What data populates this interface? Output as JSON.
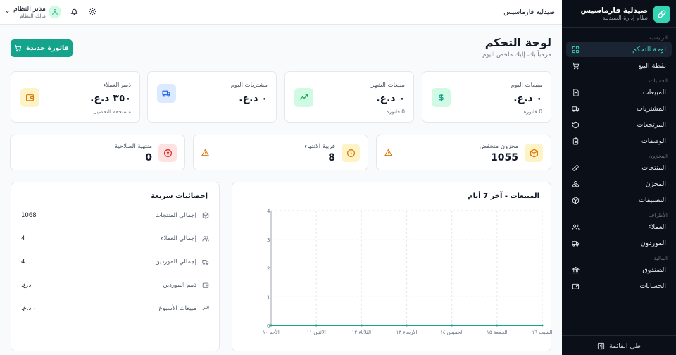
{
  "sidebar": {
    "brand_name": "صيدلية فارماسيس",
    "brand_sub": "نظام إدارة الصيدلية",
    "sections": {
      "main": "الرئيسية",
      "operations": "العمليات",
      "stock": "المخزون",
      "parties": "الأطراف",
      "finance": "المالية"
    },
    "items": {
      "dashboard": "لوحة التحكم",
      "pos": "نقطة البيع",
      "sales": "المبيعات",
      "purchases": "المشتريات",
      "returns": "المرتجعات",
      "prescriptions": "الوصفات",
      "products": "المنتجات",
      "warehouse": "المخزن",
      "categories": "التصنيفات",
      "customers": "العملاء",
      "suppliers": "الموردون",
      "cashbox": "الصندوق",
      "accounts": "الحسابات"
    },
    "collapse_label": "طي القائمة",
    "colors": {
      "background": "#0b0f17",
      "accent": "#34d3b3"
    }
  },
  "topbar": {
    "store_name": "صيدلية فارماسيس",
    "user_name": "مدير النظام",
    "user_role": "مالك النظام"
  },
  "page": {
    "title": "لوحة التحكم",
    "subtitle": "مرحباً بك، إليك ملخص اليوم",
    "new_invoice_label": "فاتورة جديدة"
  },
  "stats": {
    "today_sales": {
      "label": "مبيعات اليوم",
      "value": "٠ د.ع.",
      "note": "0 فاتورة"
    },
    "month_sales": {
      "label": "مبيعات الشهر",
      "value": "٠ د.ع.",
      "note": "0 فاتورة"
    },
    "today_purchases": {
      "label": "مشتريات اليوم",
      "value": "٠ د.ع."
    },
    "receivables": {
      "label": "ذمم العملاء",
      "value": "٣٥٠ د.ع.",
      "note": "مستحقة التحصيل"
    }
  },
  "alerts": {
    "low_stock": {
      "label": "مخزون منخفض",
      "value": "1055"
    },
    "near_expiry": {
      "label": "قريبة الانتهاء",
      "value": "8"
    },
    "expired": {
      "label": "منتهية الصلاحية",
      "value": "0"
    }
  },
  "quick_stats": {
    "title": "إحصائيات سريعة",
    "rows": [
      {
        "label": "إجمالي المنتجات",
        "value": "1068"
      },
      {
        "label": "إجمالي العملاء",
        "value": "4"
      },
      {
        "label": "إجمالي الموردين",
        "value": "4"
      },
      {
        "label": "ذمم الموردين",
        "value": "٠ د.ع."
      },
      {
        "label": "مبيعات الأسبوع",
        "value": "٠ د.ع."
      }
    ]
  },
  "chart_data": {
    "type": "area",
    "title": "المبيعات - آخر 7 أيام",
    "categories": [
      "السبت ١٦",
      "الجمعة ١٥",
      "الخميس ١٤",
      "الأربعاء ١٣",
      "الثلاثاء ١٢",
      "الاثنين ١١",
      "الأحد ١٠"
    ],
    "values": [
      0,
      0,
      0,
      0,
      0,
      0,
      0
    ],
    "y_ticks": [
      "0",
      "1",
      "2",
      "3",
      "4"
    ],
    "ylim": [
      0,
      4
    ],
    "color": "#14a38b"
  }
}
